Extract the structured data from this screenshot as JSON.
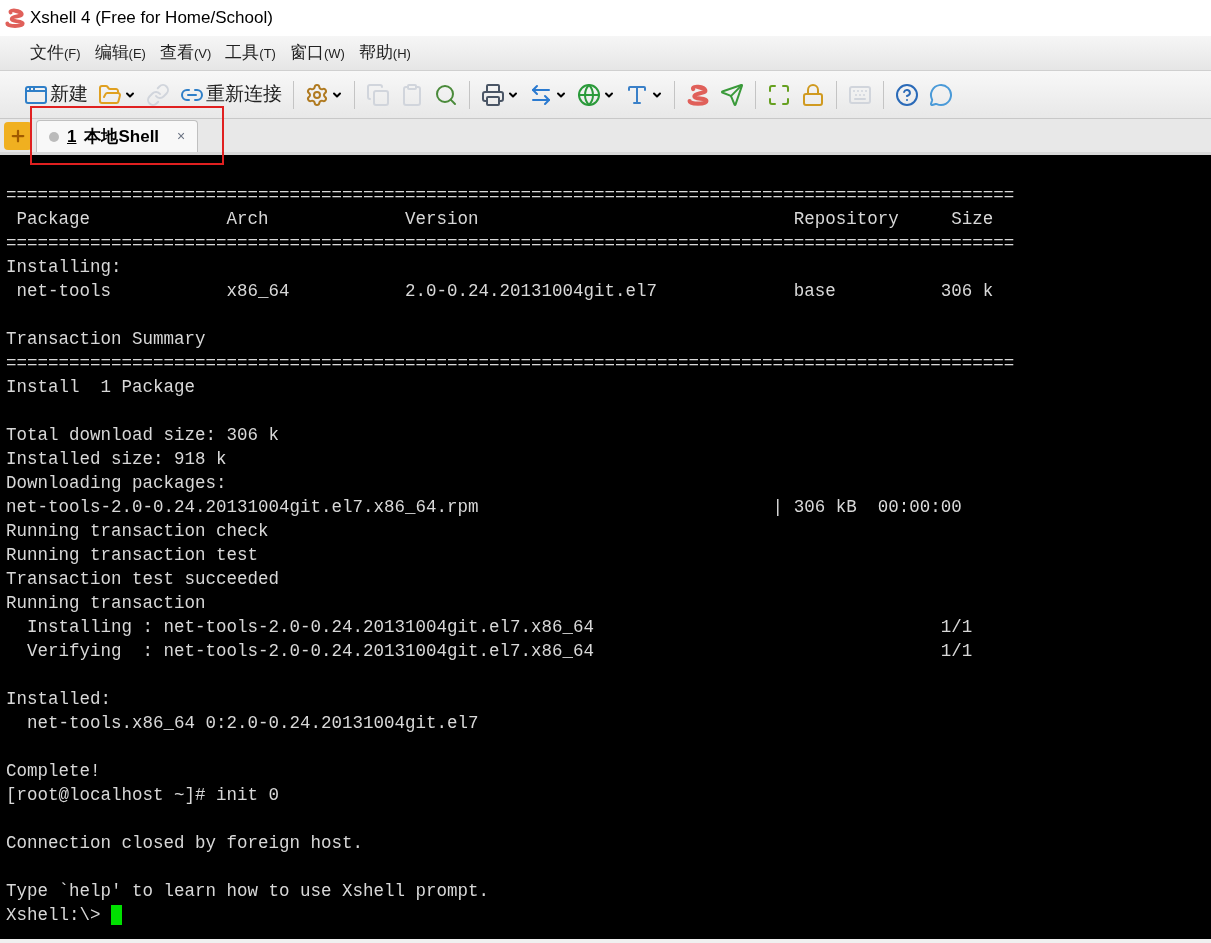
{
  "window": {
    "title": "Xshell 4 (Free for Home/School)"
  },
  "menu": [
    {
      "label": "文件",
      "accelerator": "(F)"
    },
    {
      "label": "编辑",
      "accelerator": "(E)"
    },
    {
      "label": "查看",
      "accelerator": "(V)"
    },
    {
      "label": "工具",
      "accelerator": "(T)"
    },
    {
      "label": "窗口",
      "accelerator": "(W)"
    },
    {
      "label": "帮助",
      "accelerator": "(H)"
    }
  ],
  "toolbar": [
    {
      "kind": "button",
      "label": "新建",
      "disabled": false,
      "dropdown": false
    },
    {
      "kind": "button",
      "disabled": false,
      "dropdown": true
    },
    {
      "kind": "button",
      "disabled": true,
      "dropdown": false
    },
    {
      "kind": "button",
      "label": "重新连接",
      "disabled": false,
      "dropdown": false
    },
    {
      "kind": "separator"
    },
    {
      "kind": "button",
      "disabled": false,
      "dropdown": true
    },
    {
      "kind": "separator"
    },
    {
      "kind": "button",
      "disabled": true,
      "dropdown": false
    },
    {
      "kind": "button",
      "disabled": true,
      "dropdown": false
    },
    {
      "kind": "button",
      "disabled": false,
      "dropdown": false
    },
    {
      "kind": "separator"
    },
    {
      "kind": "button",
      "disabled": false,
      "dropdown": true
    },
    {
      "kind": "button",
      "disabled": false,
      "dropdown": true
    },
    {
      "kind": "button",
      "disabled": false,
      "dropdown": true
    },
    {
      "kind": "button",
      "disabled": false,
      "dropdown": true
    },
    {
      "kind": "separator"
    },
    {
      "kind": "button",
      "disabled": false,
      "dropdown": false
    },
    {
      "kind": "button",
      "disabled": false,
      "dropdown": false
    },
    {
      "kind": "separator"
    },
    {
      "kind": "button",
      "disabled": false,
      "dropdown": false
    },
    {
      "kind": "button",
      "disabled": false,
      "dropdown": false
    },
    {
      "kind": "separator"
    },
    {
      "kind": "button",
      "disabled": true,
      "dropdown": false
    },
    {
      "kind": "separator"
    },
    {
      "kind": "button",
      "disabled": false,
      "dropdown": false
    },
    {
      "kind": "button",
      "disabled": false,
      "dropdown": false
    }
  ],
  "tabs": [
    {
      "number": "1",
      "label": "本地Shell",
      "selected": true,
      "highlighted": true,
      "close": "×"
    }
  ],
  "terminal": {
    "blocks": [
      [
        "================================================================================================",
        " Package             Arch             Version                              Repository     Size",
        "================================================================================================",
        "Installing:",
        " net-tools           x86_64           2.0-0.24.20131004git.el7             base          306 k"
      ],
      [
        "Transaction Summary",
        "================================================================================================",
        "Install  1 Package"
      ],
      [
        "Total download size: 306 k",
        "Installed size: 918 k",
        "Downloading packages:",
        "net-tools-2.0-0.24.20131004git.el7.x86_64.rpm                            | 306 kB  00:00:00",
        "Running transaction check",
        "Running transaction test",
        "Transaction test succeeded",
        "Running transaction",
        "  Installing : net-tools-2.0-0.24.20131004git.el7.x86_64                                 1/1",
        "  Verifying  : net-tools-2.0-0.24.20131004git.el7.x86_64                                 1/1"
      ],
      [
        "Installed:",
        "  net-tools.x86_64 0:2.0-0.24.20131004git.el7"
      ],
      [
        "Complete!",
        "[root@localhost ~]# init 0"
      ],
      [
        "Connection closed by foreign host."
      ],
      [
        "Type `help' to learn how to use Xshell prompt."
      ]
    ],
    "prompt": "Xshell:\\>",
    "cursor": true
  }
}
